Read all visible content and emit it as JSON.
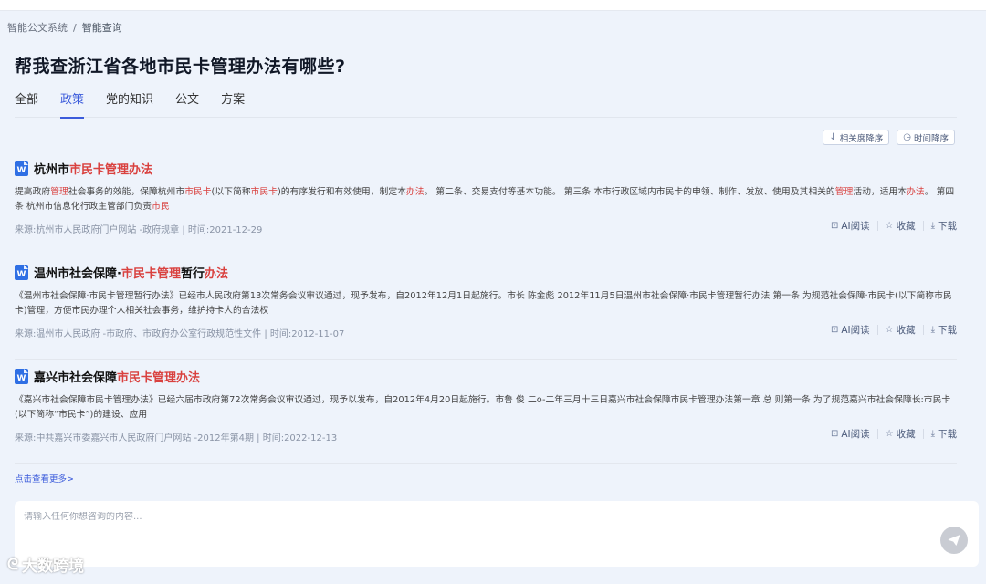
{
  "breadcrumb": {
    "root": "智能公文系统",
    "separator": "/",
    "current": "智能查询"
  },
  "query_title": "帮我查浙江省各地市民卡管理办法有哪些?",
  "tabs": [
    {
      "label": "全部"
    },
    {
      "label": "政策",
      "active": true
    },
    {
      "label": "党的知识"
    },
    {
      "label": "公文"
    },
    {
      "label": "方案"
    }
  ],
  "sort": {
    "relevance_label": "相关度降序",
    "time_label": "时间降序"
  },
  "results": [
    {
      "doc_icon": "word-doc-icon",
      "title_parts": [
        {
          "text": "杭州市",
          "hl": false
        },
        {
          "text": "市民卡管理办法",
          "hl": true
        }
      ],
      "snippet_parts": [
        {
          "text": "提高政府",
          "hl": false
        },
        {
          "text": "管理",
          "hl": true
        },
        {
          "text": "社会事务的效能，保障杭州市",
          "hl": false
        },
        {
          "text": "市民卡",
          "hl": true
        },
        {
          "text": "(以下简称",
          "hl": false
        },
        {
          "text": "市民卡",
          "hl": true
        },
        {
          "text": ")的有序发行和有效使用，制定本",
          "hl": false
        },
        {
          "text": "办法",
          "hl": true
        },
        {
          "text": "。 第二条、交易支付等基本功能。 第三条 本市行政区域内市民卡的申领、制作、发放、使用及其相关的",
          "hl": false
        },
        {
          "text": "管理",
          "hl": true
        },
        {
          "text": "活动，适用本",
          "hl": false
        },
        {
          "text": "办法",
          "hl": true
        },
        {
          "text": "。 第四条 杭州市信息化行政主管部门负责",
          "hl": false
        },
        {
          "text": "市民",
          "hl": true
        }
      ],
      "source": "来源:杭州市人民政府门户网站 -政府规章 | 时间:2021-12-29"
    },
    {
      "doc_icon": "word-doc-icon",
      "title_parts": [
        {
          "text": "温州市社会保障·",
          "hl": false
        },
        {
          "text": "市民卡管理",
          "hl": true
        },
        {
          "text": "暂行",
          "hl": false
        },
        {
          "text": "办法",
          "hl": true
        }
      ],
      "snippet_parts": [
        {
          "text": "《温州市社会保障·市民卡管理暂行办法》已经市人民政府第13次常务会议审议通过，现予发布，自2012年12月1日起施行。市长 陈金彪 2012年11月5日温州市社会保障·市民卡管理暂行办法 第一条 为规范社会保障·市民卡(以下简称市民卡)管理，方便市民办理个人相关社会事务，维护持卡人的合法权",
          "hl": false
        }
      ],
      "source": "来源:温州市人民政府 -市政府、市政府办公室行政规范性文件 | 时间:2012-11-07"
    },
    {
      "doc_icon": "word-doc-icon",
      "title_parts": [
        {
          "text": "嘉兴市社会保障",
          "hl": false
        },
        {
          "text": "市民卡管理办法",
          "hl": true
        }
      ],
      "snippet_parts": [
        {
          "text": "《嘉兴市社会保障市民卡管理办法》已经六届市政府第72次常务会议审议通过，现予以发布，自2012年4月20日起施行。市鲁 俊 二o-二年三月十三日嘉兴市社会保障市民卡管理办法第一章 总 则第一条 为了规范嘉兴市社会保障长:市民卡(以下简称“市民卡”)的建设、应用",
          "hl": false
        }
      ],
      "source": "来源:中共嘉兴市委嘉兴市人民政府门户网站 -2012年第4期 | 时间:2022-12-13"
    }
  ],
  "actions": {
    "ai_read": "AI阅读",
    "favorite": "收藏",
    "download": "下载"
  },
  "more_label": "点击查看更多>",
  "chat": {
    "placeholder": "请输入任何你想咨询的内容..."
  },
  "watermark": "大数跨境",
  "colors": {
    "accent": "#3b5bdb",
    "highlight": "#d9413f",
    "doc_icon": "#2f6fe4",
    "background": "#eef3fb"
  }
}
